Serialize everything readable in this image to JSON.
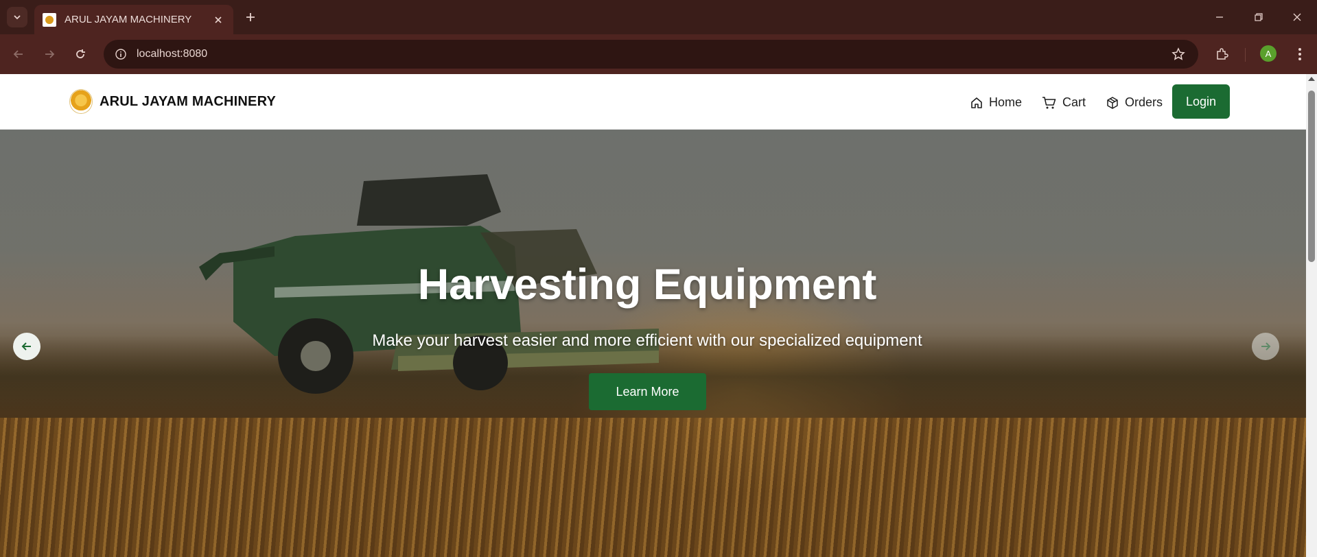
{
  "browser": {
    "tab_title": "ARUL JAYAM MACHINERY",
    "url": "localhost:8080",
    "profile_initial": "A"
  },
  "site": {
    "brand": "ARUL JAYAM MACHINERY",
    "nav": {
      "home": "Home",
      "cart": "Cart",
      "orders": "Orders",
      "login": "Login"
    }
  },
  "hero": {
    "title": "Harvesting Equipment",
    "subtitle": "Make your harvest easier and more efficient with our specialized equipment",
    "cta": "Learn More"
  },
  "colors": {
    "brand_green": "#1b6b32",
    "chrome_dark": "#3a1d19",
    "chrome_mid": "#4e2420"
  },
  "icons": [
    "chevron-down-icon",
    "close-icon",
    "plus-icon",
    "minimize-icon",
    "restore-icon",
    "window-close-icon",
    "back-arrow-icon",
    "forward-arrow-icon",
    "reload-icon",
    "info-icon",
    "star-icon",
    "extensions-icon",
    "more-vert-icon",
    "home-icon",
    "cart-icon",
    "package-icon",
    "arrow-left-icon",
    "arrow-right-icon"
  ]
}
